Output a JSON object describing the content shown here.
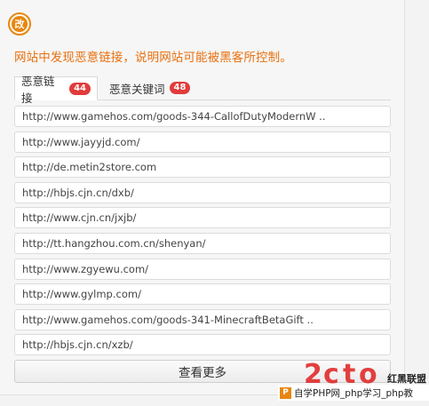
{
  "header": {
    "icon_char": "改",
    "message": "网站中发现恶意链接，说明网站可能被黑客所控制。"
  },
  "tabs": [
    {
      "label": "恶意链接",
      "count": "44",
      "active": true
    },
    {
      "label": "恶意关键词",
      "count": "48",
      "active": false
    }
  ],
  "links": [
    "http://www.gamehos.com/goods-344-CallofDutyModernW ..",
    "http://www.jayyjd.com/",
    "http://de.metin2store.com",
    "http://hbjs.cjn.cn/dxb/",
    "http://www.cjn.cn/jxjb/",
    "http://tt.hangzhou.com.cn/shenyan/",
    "http://www.zgyewu.com/",
    "http://www.gylmp.com/",
    "http://www.gamehos.com/goods-341-MinecraftBetaGift ..",
    "http://hbjs.cjn.cn/xzb/"
  ],
  "more_button": "查看更多",
  "watermark": {
    "brand": "红黑联盟",
    "p_char": "P",
    "bar_text": "自学PHP网_php学习_php教"
  },
  "colors": {
    "accent": "#e8700f",
    "badge": "#e23b3b"
  }
}
